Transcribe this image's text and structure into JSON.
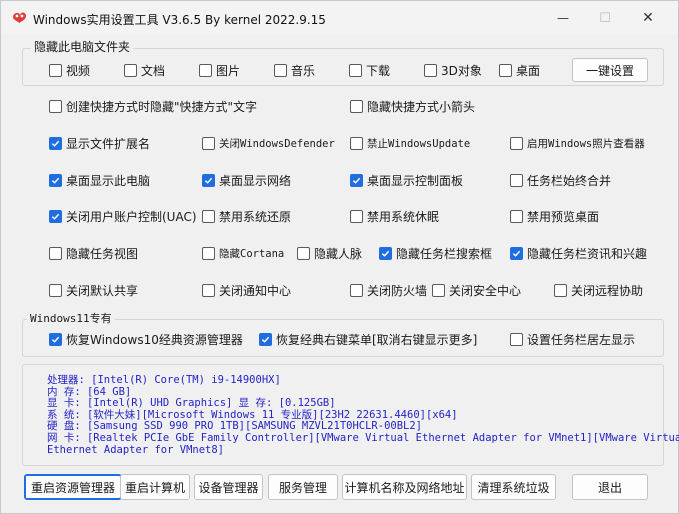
{
  "window": {
    "title": "Windows实用设置工具 V3.6.5 By kernel 2022.9.15",
    "minimize_symbol": "—",
    "maximize_symbol": "☐",
    "close_symbol": "✕"
  },
  "group_hide_folders": {
    "legend": "隐藏此电脑文件夹",
    "items": [
      {
        "label": "视频",
        "checked": false
      },
      {
        "label": "文档",
        "checked": false
      },
      {
        "label": "图片",
        "checked": false
      },
      {
        "label": "音乐",
        "checked": false
      },
      {
        "label": "下载",
        "checked": false
      },
      {
        "label": "3D对象",
        "checked": false
      },
      {
        "label": "桌面",
        "checked": false
      }
    ],
    "one_click_label": "一键设置"
  },
  "options": [
    {
      "label": "创建快捷方式时隐藏\"快捷方式\"文字",
      "checked": false
    },
    {
      "label": "隐藏快捷方式小箭头",
      "checked": false
    },
    {
      "label": "显示文件扩展名",
      "checked": true
    },
    {
      "label": "关闭WindowsDefender",
      "checked": false
    },
    {
      "label": "禁止WindowsUpdate",
      "checked": false
    },
    {
      "label": "启用Windows照片查看器",
      "checked": false
    },
    {
      "label": "桌面显示此电脑",
      "checked": true
    },
    {
      "label": "桌面显示网络",
      "checked": true
    },
    {
      "label": "桌面显示控制面板",
      "checked": true
    },
    {
      "label": "任务栏始终合并",
      "checked": false
    },
    {
      "label": "关闭用户账户控制(UAC)",
      "checked": true
    },
    {
      "label": "禁用系统还原",
      "checked": false
    },
    {
      "label": "禁用系统休眠",
      "checked": false
    },
    {
      "label": "禁用预览桌面",
      "checked": false
    },
    {
      "label": "隐藏任务视图",
      "checked": false
    },
    {
      "label": "隐藏Cortana",
      "checked": false
    },
    {
      "label": "隐藏人脉",
      "checked": false
    },
    {
      "label": "隐藏任务栏搜索框",
      "checked": true
    },
    {
      "label": "隐藏任务栏资讯和兴趣",
      "checked": true
    },
    {
      "label": "关闭默认共享",
      "checked": false
    },
    {
      "label": "关闭通知中心",
      "checked": false
    },
    {
      "label": "关闭防火墙",
      "checked": false
    },
    {
      "label": "关闭安全中心",
      "checked": false
    },
    {
      "label": "关闭远程协助",
      "checked": false
    }
  ],
  "group_win11": {
    "legend": "Windows11专有",
    "items": [
      {
        "label": "恢复Windows10经典资源管理器",
        "checked": true
      },
      {
        "label": "恢复经典右键菜单[取消右键显示更多]",
        "checked": true
      },
      {
        "label": "设置任务栏居左显示",
        "checked": false
      }
    ]
  },
  "system_info": [
    "处理器: [Intel(R) Core(TM) i9-14900HX]",
    "内  存: [64 GB]",
    "显  卡: [Intel(R) UHD Graphics]  显 存: [0.125GB]",
    "系  统: [软件大妹][Microsoft Windows 11 专业版][23H2 22631.4460][x64]",
    "硬  盘: [Samsung SSD 990 PRO 1TB][SAMSUNG MZVL21T0HCLR-00BL2]",
    "网  卡: [Realtek PCIe GbE Family Controller][VMware Virtual Ethernet Adapter for VMnet1][VMware Virtual",
    "Ethernet Adapter for VMnet8]"
  ],
  "buttons": [
    "重启资源管理器",
    "重启计算机",
    "设备管理器",
    "服务管理",
    "计算机名称及网络地址",
    "清理系统垃圾",
    "退出"
  ],
  "colors": {
    "accent": "#1f6ee0",
    "info_text": "#2323c8"
  }
}
